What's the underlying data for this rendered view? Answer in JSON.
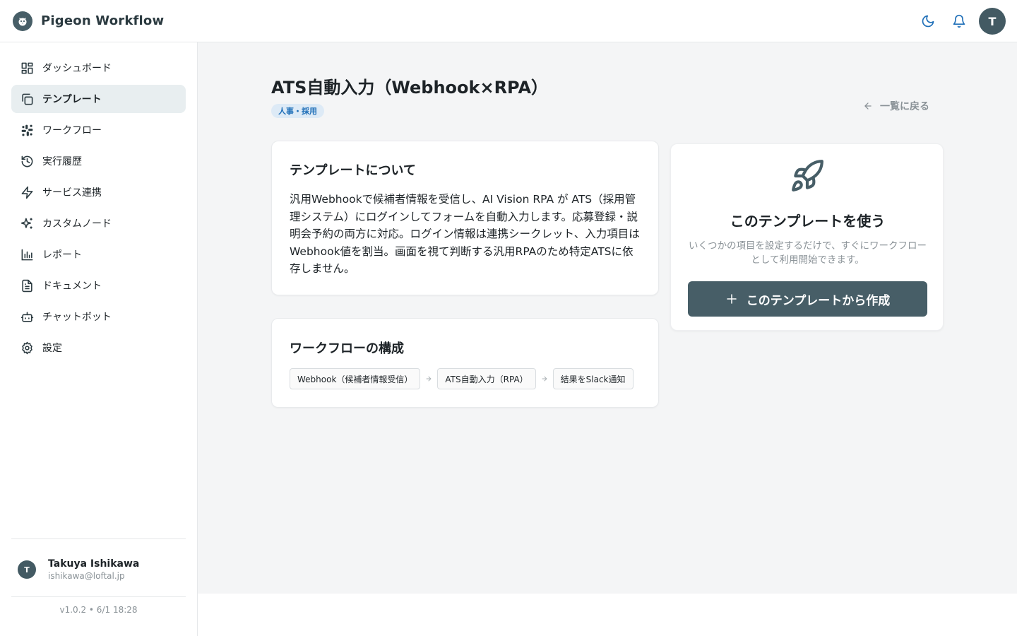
{
  "app": {
    "name": "Pigeon Workflow"
  },
  "header": {
    "icons": [
      "moon-icon",
      "bell-icon"
    ],
    "avatar_initial": "T"
  },
  "sidebar": {
    "items": [
      {
        "label": "ダッシュボード",
        "icon": "dashboard-icon",
        "active": false
      },
      {
        "label": "テンプレート",
        "icon": "copy-icon",
        "active": true
      },
      {
        "label": "ワークフロー",
        "icon": "workflow-icon",
        "active": false
      },
      {
        "label": "実行履歴",
        "icon": "history-icon",
        "active": false
      },
      {
        "label": "サービス連携",
        "icon": "lightning-icon",
        "active": false
      },
      {
        "label": "カスタムノード",
        "icon": "sparkles-icon",
        "active": false
      },
      {
        "label": "レポート",
        "icon": "bar-chart-icon",
        "active": false
      },
      {
        "label": "ドキュメント",
        "icon": "document-icon",
        "active": false
      },
      {
        "label": "チャットボット",
        "icon": "bot-icon",
        "active": false
      },
      {
        "label": "設定",
        "icon": "gear-icon",
        "active": false
      }
    ],
    "user": {
      "initial": "T",
      "name": "Takuya Ishikawa",
      "email": "ishikawa@loftal.jp"
    },
    "version": "v1.0.2 • 6/1 18:28"
  },
  "page": {
    "title": "ATS自動入力（Webhook×RPA）",
    "category": "人事・採用",
    "back_label": "一覧に戻る"
  },
  "about": {
    "title": "テンプレートについて",
    "description": "汎用Webhookで候補者情報を受信し、AI Vision RPA が ATS（採用管理システム）にログインしてフォームを自動入力します。応募登録・説明会予約の両方に対応。ログイン情報は連携シークレット、入力項目はWebhook値を割当。画面を視て判断する汎用RPAのため特定ATSに依存しません。"
  },
  "flow": {
    "title": "ワークフローの構成",
    "steps": [
      "Webhook（候補者情報受信）",
      "ATS自動入力（RPA）",
      "結果をSlack通知"
    ]
  },
  "use": {
    "icon": "rocket-icon",
    "title": "このテンプレートを使う",
    "description": "いくつかの項目を設定するだけで、すぐにワークフローとして利用開始できます。",
    "button_label": "このテンプレートから作成"
  },
  "colors": {
    "primary": "#475e67",
    "accent_blue": "#1f6fb8",
    "active_bg": "#e8eef0",
    "main_bg": "#f4f5f6"
  }
}
